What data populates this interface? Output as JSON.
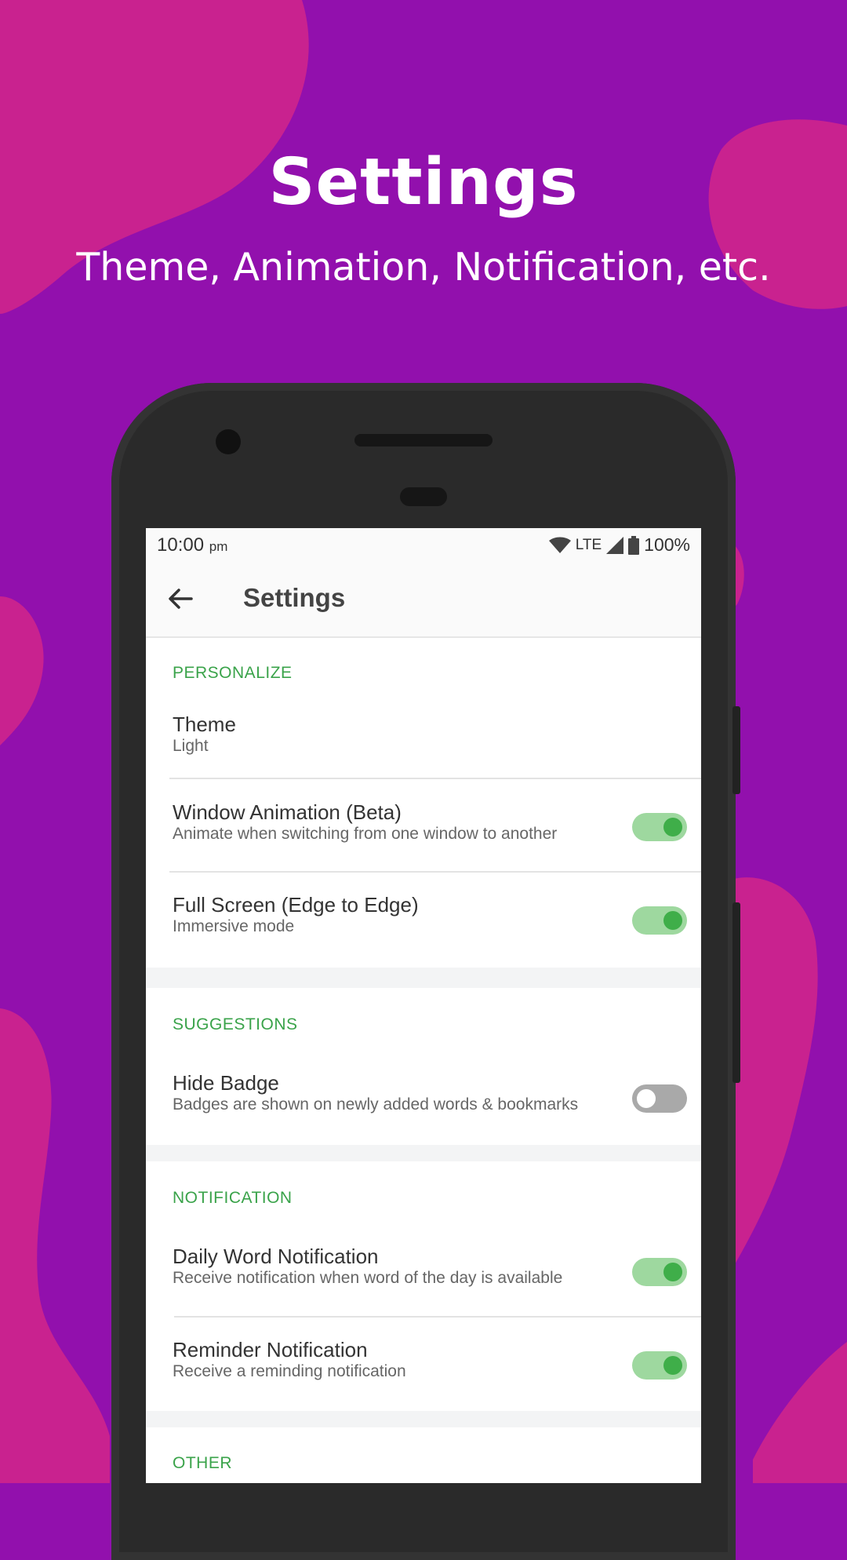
{
  "promo": {
    "title": "Settings",
    "subtitle": "Theme, Animation, Notification, etc."
  },
  "status_bar": {
    "time": "10:00",
    "ampm": "pm",
    "network": "LTE",
    "battery": "100%"
  },
  "toolbar": {
    "title": "Settings",
    "back_icon": "arrow-back-icon"
  },
  "sections": {
    "personalize": {
      "header": "PERSONALIZE",
      "theme": {
        "title": "Theme",
        "subtitle": "Light"
      },
      "window_animation": {
        "title": "Window Animation (Beta)",
        "subtitle": "Animate when switching from one window to another",
        "enabled": true
      },
      "full_screen": {
        "title": "Full Screen (Edge to Edge)",
        "subtitle": "Immersive mode",
        "enabled": true
      }
    },
    "suggestions": {
      "header": "SUGGESTIONS",
      "hide_badge": {
        "title": "Hide Badge",
        "subtitle": "Badges are shown on newly added words & bookmarks",
        "enabled": false
      }
    },
    "notification": {
      "header": "NOTIFICATION",
      "daily_word": {
        "title": "Daily Word Notification",
        "subtitle": "Receive notification when word of the day is available",
        "enabled": true
      },
      "reminder": {
        "title": "Reminder Notification",
        "subtitle": "Receive a reminding notification",
        "enabled": true
      }
    },
    "other": {
      "header": "OTHER"
    }
  },
  "colors": {
    "background": "#9210ad",
    "blob": "#c9228f",
    "accent_green": "#3aa34a",
    "toggle_on_track": "#9ed89f",
    "toggle_on_knob": "#3fae49"
  }
}
